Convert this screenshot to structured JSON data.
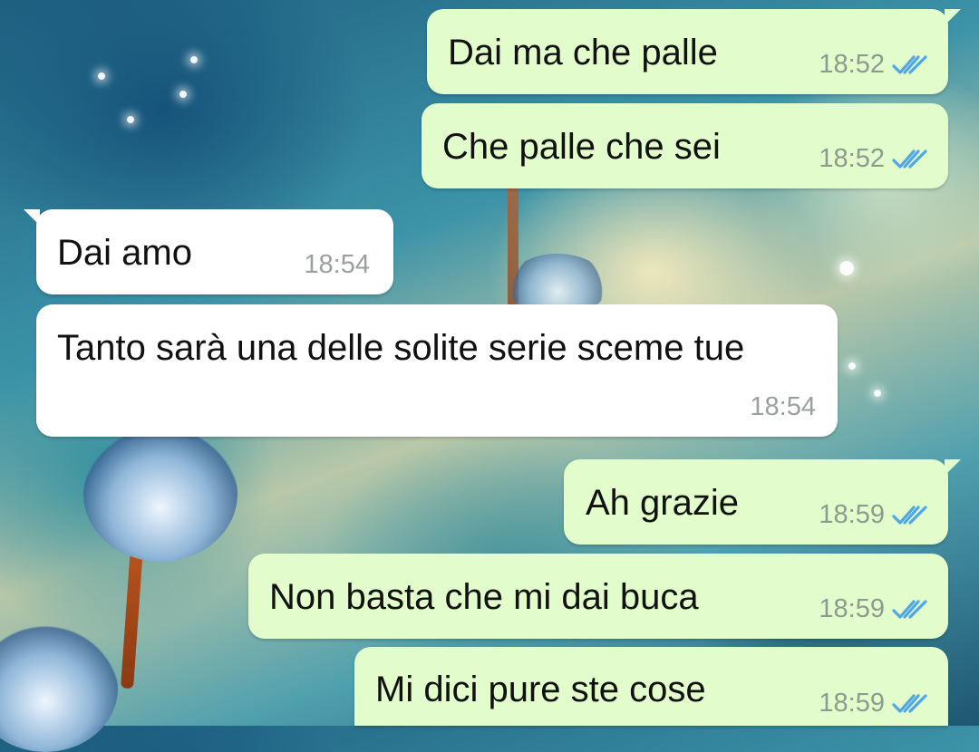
{
  "chat": {
    "messages": [
      {
        "direction": "outgoing",
        "text": "Dai ma che palle",
        "time": "18:52",
        "status_icon": "double-check-read-icon"
      },
      {
        "direction": "outgoing",
        "text": "Che palle che sei",
        "time": "18:52",
        "status_icon": "double-check-read-icon"
      },
      {
        "direction": "incoming",
        "text": "Dai amo",
        "time": "18:54"
      },
      {
        "direction": "incoming",
        "text": "Tanto sarà una delle solite serie sceme tue",
        "time": "18:54"
      },
      {
        "direction": "outgoing",
        "text": "Ah grazie",
        "time": "18:59",
        "status_icon": "double-check-read-icon"
      },
      {
        "direction": "outgoing",
        "text": "Non basta che mi dai buca",
        "time": "18:59",
        "status_icon": "double-check-read-icon"
      },
      {
        "direction": "outgoing",
        "text": "Mi dici pure ste cose",
        "time": "18:59",
        "status_icon": "double-check-read-icon"
      }
    ]
  },
  "colors": {
    "outgoing_bubble": "#e2fdcb",
    "incoming_bubble": "#ffffff",
    "read_ticks": "#4fa6e8",
    "timestamp": "#8c9a90"
  },
  "wallpaper": "dandelion-photo"
}
